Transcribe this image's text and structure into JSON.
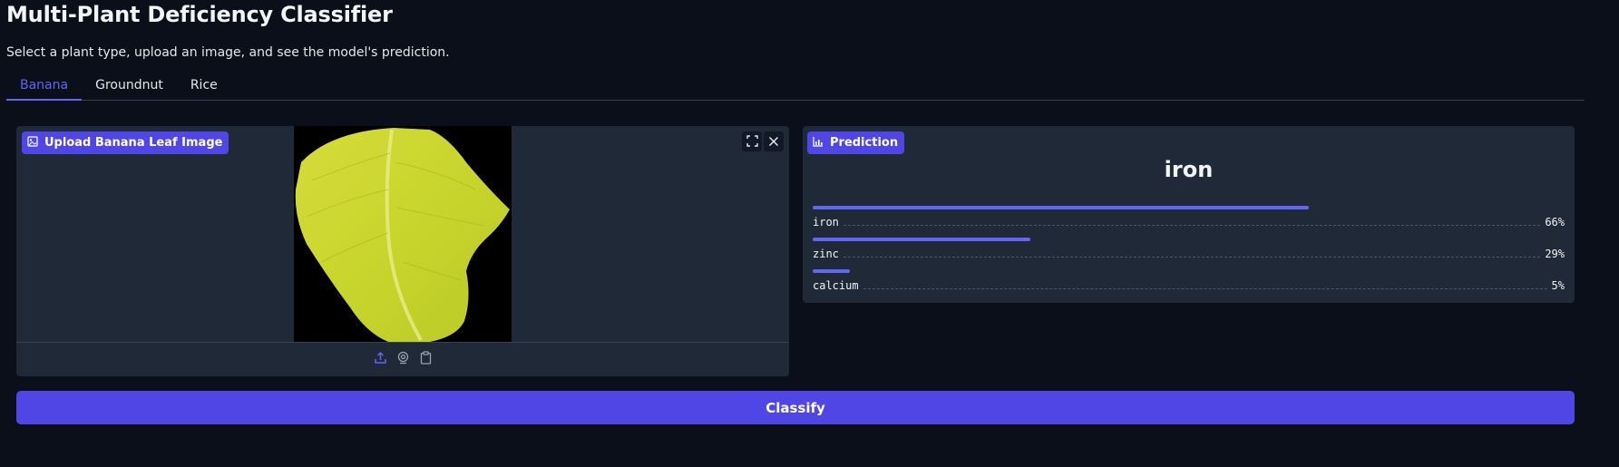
{
  "header": {
    "title": "Multi-Plant Deficiency Classifier",
    "subtitle": "Select a plant type, upload an image, and see the model's prediction."
  },
  "tabs": [
    {
      "label": "Banana",
      "active": true
    },
    {
      "label": "Groundnut",
      "active": false
    },
    {
      "label": "Rice",
      "active": false
    }
  ],
  "upload": {
    "label": "Upload Banana Leaf Image",
    "icons": [
      "image-icon",
      "fullscreen-icon",
      "close-icon",
      "upload-icon",
      "webcam-icon",
      "clipboard-icon"
    ]
  },
  "prediction": {
    "label": "Prediction",
    "top_class": "iron",
    "confidences": [
      {
        "name": "iron",
        "pct_label": "66%",
        "value": 0.66
      },
      {
        "name": "zinc",
        "pct_label": "29%",
        "value": 0.29
      },
      {
        "name": "calcium",
        "pct_label": "5%",
        "value": 0.05
      }
    ]
  },
  "actions": {
    "classify_label": "Classify"
  },
  "colors": {
    "accent": "#6366f1",
    "button": "#4f46e5",
    "background": "#0b0f19",
    "panel": "#1f2937"
  }
}
